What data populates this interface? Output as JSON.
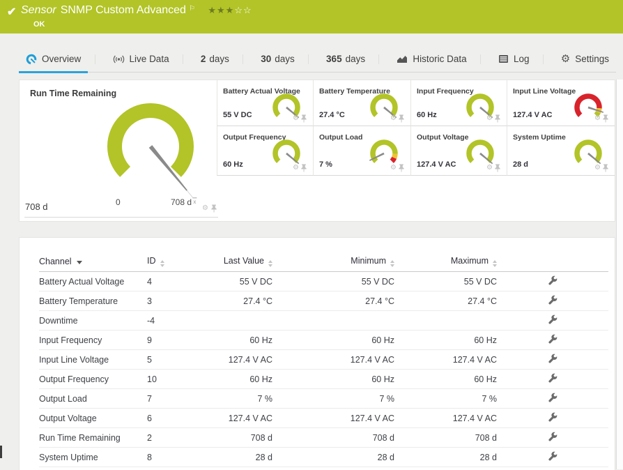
{
  "colors": {
    "green": "#b2c427",
    "red": "#d9232b",
    "yellow": "#eec431",
    "blue": "#1f9ed9",
    "needle": "#8a8a8a"
  },
  "header": {
    "type_label": "Sensor",
    "title": "SNMP Custom Advanced",
    "status": "OK",
    "stars_filled": "★★★",
    "stars_empty": "☆☆"
  },
  "tabs": [
    {
      "name": "overview",
      "icon": "gauge-icon",
      "label": "Overview",
      "active": true
    },
    {
      "name": "live-data",
      "icon": "signal-icon",
      "label": "Live Data"
    },
    {
      "name": "2-days",
      "num": "2",
      "label": "days"
    },
    {
      "name": "30-days",
      "num": "30",
      "label": "days"
    },
    {
      "name": "365-days",
      "num": "365",
      "label": "days"
    },
    {
      "name": "historic-data",
      "icon": "chart-icon",
      "label": "Historic Data"
    },
    {
      "name": "log",
      "icon": "log-icon",
      "label": "Log"
    },
    {
      "name": "settings",
      "icon": "gear-icon",
      "label": "Settings"
    }
  ],
  "gauges": {
    "main": {
      "title": "Run Time Remaining",
      "value": "708 d",
      "scale_min": "0",
      "scale_max": "708 d",
      "needle": 1.02,
      "segments": [
        {
          "color": "green",
          "from": 0,
          "to": 1
        }
      ]
    },
    "small": [
      {
        "title": "Battery Actual Voltage",
        "value": "55 V DC",
        "needle": 0.98,
        "segments": [
          {
            "color": "green",
            "from": 0,
            "to": 1
          }
        ]
      },
      {
        "title": "Battery Temperature",
        "value": "27.4 °C",
        "needle": 0.98,
        "segments": [
          {
            "color": "green",
            "from": 0,
            "to": 1
          }
        ]
      },
      {
        "title": "Input Frequency",
        "value": "60 Hz",
        "needle": 0.98,
        "segments": [
          {
            "color": "green",
            "from": 0,
            "to": 1
          }
        ]
      },
      {
        "title": "Input Line Voltage",
        "value": "127.4 V AC",
        "needle": 0.9,
        "segments": [
          {
            "color": "red",
            "from": 0,
            "to": 0.85
          },
          {
            "color": "yellow",
            "from": 0.85,
            "to": 0.93
          },
          {
            "color": "green",
            "from": 0.93,
            "to": 1
          }
        ]
      },
      {
        "title": "Output Frequency",
        "value": "60 Hz",
        "needle": 0.98,
        "segments": [
          {
            "color": "green",
            "from": 0,
            "to": 1
          }
        ]
      },
      {
        "title": "Output Load",
        "value": "7 %",
        "needle": 0.07,
        "segments": [
          {
            "color": "green",
            "from": 0,
            "to": 0.84
          },
          {
            "color": "yellow",
            "from": 0.84,
            "to": 0.92
          },
          {
            "color": "red",
            "from": 0.92,
            "to": 1
          }
        ]
      },
      {
        "title": "Output Voltage",
        "value": "127.4 V AC",
        "needle": 0.98,
        "segments": [
          {
            "color": "green",
            "from": 0,
            "to": 1
          }
        ]
      },
      {
        "title": "System Uptime",
        "value": "28 d",
        "needle": 0.98,
        "segments": [
          {
            "color": "green",
            "from": 0,
            "to": 1
          }
        ]
      }
    ]
  },
  "table": {
    "columns": [
      {
        "label": "Channel",
        "sort": "active-desc"
      },
      {
        "label": "ID",
        "sort": "both"
      },
      {
        "label": "Last Value",
        "sort": "both"
      },
      {
        "label": "Minimum",
        "sort": "both"
      },
      {
        "label": "Maximum",
        "sort": "both"
      }
    ],
    "rows": [
      {
        "channel": "Battery Actual Voltage",
        "id": "4",
        "last": "55 V DC",
        "min": "55 V DC",
        "max": "55 V DC"
      },
      {
        "channel": "Battery Temperature",
        "id": "3",
        "last": "27.4 °C",
        "min": "27.4 °C",
        "max": "27.4 °C"
      },
      {
        "channel": "Downtime",
        "id": "-4",
        "last": "",
        "min": "",
        "max": ""
      },
      {
        "channel": "Input Frequency",
        "id": "9",
        "last": "60 Hz",
        "min": "60 Hz",
        "max": "60 Hz"
      },
      {
        "channel": "Input Line Voltage",
        "id": "5",
        "last": "127.4 V AC",
        "min": "127.4 V AC",
        "max": "127.4 V AC"
      },
      {
        "channel": "Output Frequency",
        "id": "10",
        "last": "60 Hz",
        "min": "60 Hz",
        "max": "60 Hz"
      },
      {
        "channel": "Output Load",
        "id": "7",
        "last": "7 %",
        "min": "7 %",
        "max": "7 %"
      },
      {
        "channel": "Output Voltage",
        "id": "6",
        "last": "127.4 V AC",
        "min": "127.4 V AC",
        "max": "127.4 V AC"
      },
      {
        "channel": "Run Time Remaining",
        "id": "2",
        "last": "708 d",
        "min": "708 d",
        "max": "708 d"
      },
      {
        "channel": "System Uptime",
        "id": "8",
        "last": "28 d",
        "min": "28 d",
        "max": "28 d"
      }
    ]
  }
}
